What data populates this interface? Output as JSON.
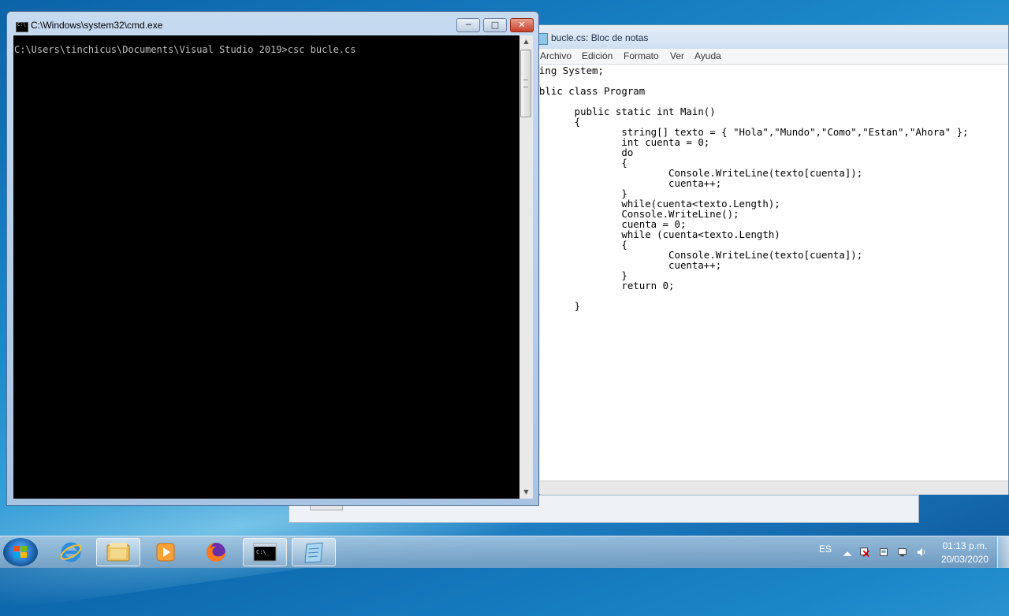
{
  "notepad": {
    "title": "bucle.cs: Bloc de notas",
    "menu": [
      "Archivo",
      "Edición",
      "Formato",
      "Ver",
      "Ayuda"
    ],
    "code_lines": [
      "using System;",
      "",
      "public class Program",
      "",
      "        public static int Main()",
      "        {",
      "                string[] texto = { \"Hola\",\"Mundo\",\"Como\",\"Estan\",\"Ahora\" };",
      "                int cuenta = 0;",
      "                do",
      "                {",
      "                        Console.WriteLine(texto[cuenta]);",
      "                        cuenta++;",
      "                }",
      "                while(cuenta<texto.Length);",
      "                Console.WriteLine();",
      "                cuenta = 0;",
      "                while (cuenta<texto.Length)",
      "                {",
      "                        Console.WriteLine(texto[cuenta]);",
      "                        cuenta++;",
      "                }",
      "                return 0;",
      "",
      "        }"
    ]
  },
  "cmd": {
    "title": "C:\\Windows\\system32\\cmd.exe",
    "line": "C:\\Users\\tinchicus\\Documents\\Visual Studio 2019>csc bucle.cs"
  },
  "taskbar": {
    "apps": [
      "start-icon",
      "internet-explorer-icon",
      "file-explorer-icon",
      "media-player-icon",
      "firefox-icon",
      "cmd-icon",
      "notepad-icon"
    ],
    "language": "ES",
    "time": "01:13 p.m.",
    "date": "20/03/2020"
  },
  "colors": {
    "cmd_background": "#000000",
    "cmd_text": "#c0c0c0",
    "close_button": "#c7402b"
  }
}
